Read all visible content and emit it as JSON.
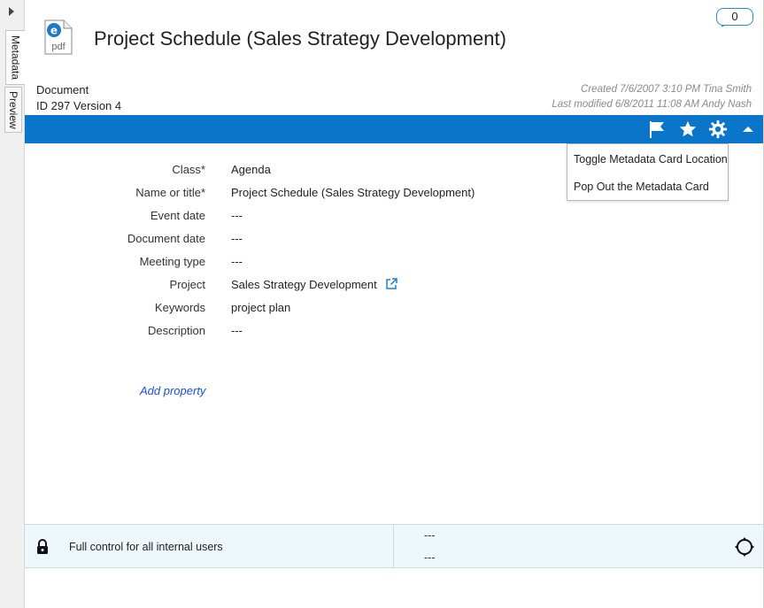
{
  "sidebar": {
    "tabs": [
      {
        "label": "Metadata"
      },
      {
        "label": "Preview"
      }
    ]
  },
  "header": {
    "title": "Project Schedule (Sales Strategy Development)",
    "file_icon_text": "pdf",
    "comment_count": "0",
    "object_type": "Document",
    "object_id": "ID 297  Version 4",
    "created": "Created 7/6/2007 3:10 PM Tina Smith",
    "modified": "Last modified 6/8/2011 11:08 AM Andy Nash"
  },
  "toolbar": {
    "icons": [
      "flag-icon",
      "star-icon",
      "gear-icon",
      "collapse-icon"
    ],
    "color": "#0a75c9"
  },
  "dropdown": {
    "items": [
      {
        "label": "Toggle Metadata Card Location"
      },
      {
        "label": "Pop Out the Metadata Card"
      }
    ]
  },
  "properties": [
    {
      "label": "Class*",
      "value": "Agenda"
    },
    {
      "label": "Name or title*",
      "value": "Project Schedule (Sales Strategy Development)"
    },
    {
      "label": "Event date",
      "value": "---"
    },
    {
      "label": "Document date",
      "value": "---"
    },
    {
      "label": "Meeting type",
      "value": "---"
    },
    {
      "label": "Project",
      "value": "Sales Strategy Development"
    },
    {
      "label": "Keywords",
      "value": "project plan"
    },
    {
      "label": "Description",
      "value": "---"
    }
  ],
  "add_property": "Add property",
  "permissions": {
    "text": "Full control for all internal users",
    "workflow": "---",
    "state": "---"
  }
}
